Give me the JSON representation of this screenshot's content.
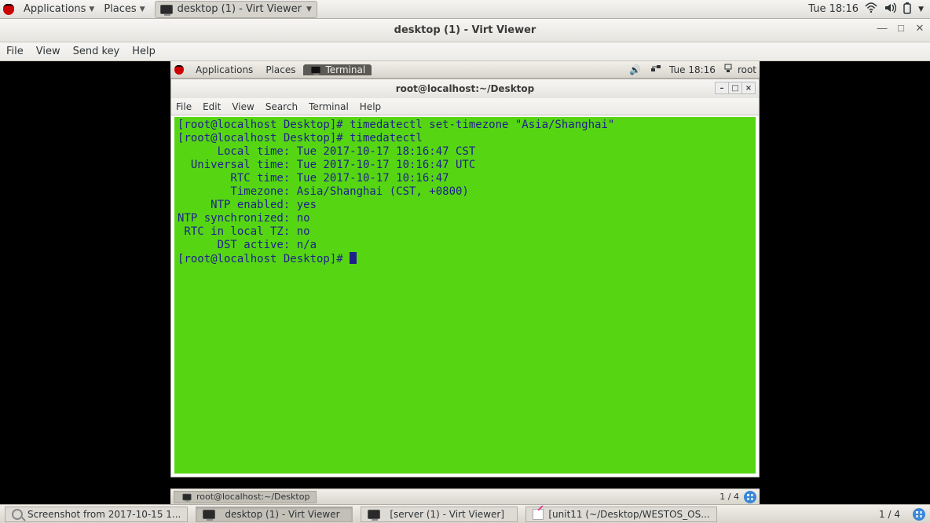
{
  "host_panel": {
    "applications": "Applications",
    "places": "Places",
    "active_window": "desktop (1) - Virt Viewer",
    "clock": "Tue 18:16"
  },
  "virt_viewer": {
    "title": "desktop (1) - Virt Viewer",
    "menu": {
      "file": "File",
      "view": "View",
      "send_key": "Send key",
      "help": "Help"
    }
  },
  "guest_panel": {
    "applications": "Applications",
    "places": "Places",
    "active_tab": "Terminal",
    "clock": "Tue 18:16",
    "user": "root"
  },
  "terminal": {
    "title": "root@localhost:~/Desktop",
    "menu": {
      "file": "File",
      "edit": "Edit",
      "view": "View",
      "search": "Search",
      "terminal": "Terminal",
      "help": "Help"
    },
    "lines": [
      "[root@localhost Desktop]# timedatectl set-timezone \"Asia/Shanghai\"",
      "[root@localhost Desktop]# timedatectl",
      "      Local time: Tue 2017-10-17 18:16:47 CST",
      "  Universal time: Tue 2017-10-17 10:16:47 UTC",
      "        RTC time: Tue 2017-10-17 10:16:47",
      "        Timezone: Asia/Shanghai (CST, +0800)",
      "     NTP enabled: yes",
      "NTP synchronized: no",
      " RTC in local TZ: no",
      "      DST active: n/a"
    ],
    "prompt": "[root@localhost Desktop]# "
  },
  "guest_bottom": {
    "task": "root@localhost:~/Desktop",
    "workspace": "1 / 4"
  },
  "host_bottom": {
    "tasks": [
      "Screenshot from 2017-10-15 1...",
      "desktop (1) - Virt Viewer",
      "[server (1) - Virt Viewer]",
      "[unit11 (~/Desktop/WESTOS_OS..."
    ],
    "workspace": "1 / 4"
  }
}
